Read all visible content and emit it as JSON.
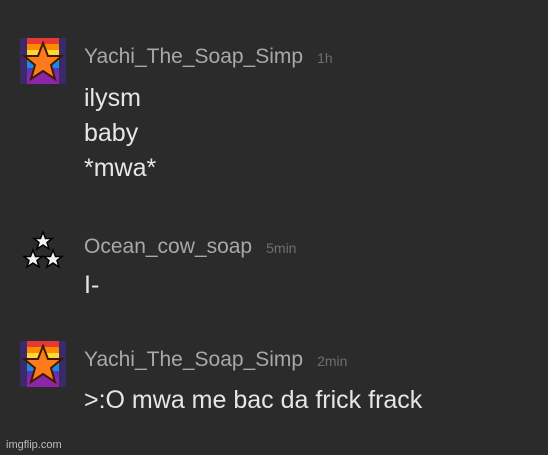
{
  "messages": [
    {
      "avatar": "rainbow-star-avatar",
      "username": "Yachi_The_Soap_Simp",
      "time": "1h",
      "lines": [
        "ilysm",
        "baby",
        "*mwa*"
      ]
    },
    {
      "avatar": "three-stars-avatar",
      "username": "Ocean_cow_soap",
      "time": "5min",
      "lines": [
        "I-"
      ]
    },
    {
      "avatar": "rainbow-star-avatar",
      "username": "Yachi_The_Soap_Simp",
      "time": "2min",
      "lines": [
        ">:O mwa me bac da frick frack"
      ]
    }
  ],
  "watermark": "imgflip.com"
}
